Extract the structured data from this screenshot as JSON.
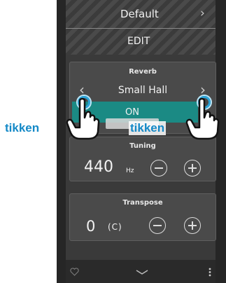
{
  "sound": {
    "name": "Default",
    "edit_label": "EDIT"
  },
  "reverb": {
    "title": "Reverb",
    "value": "Small Hall",
    "state": "ON"
  },
  "tuning": {
    "title": "Tuning",
    "value": "440",
    "unit": "Hz"
  },
  "transpose": {
    "title": "Transpose",
    "value": "0",
    "key": "(C)"
  },
  "annotations": {
    "left": "tikken",
    "right": "tikken"
  },
  "icons": [
    "heart-icon",
    "chevron-down-icon",
    "more-vertical-icon",
    "chevron-left-icon",
    "chevron-right-icon",
    "minus-icon",
    "plus-icon",
    "hand-pointer-icon"
  ],
  "colors": {
    "accent": "#1489c7",
    "toggle_on": "#1b8a84",
    "panel": "#4a4a4a",
    "background": "#3a3a3a"
  }
}
